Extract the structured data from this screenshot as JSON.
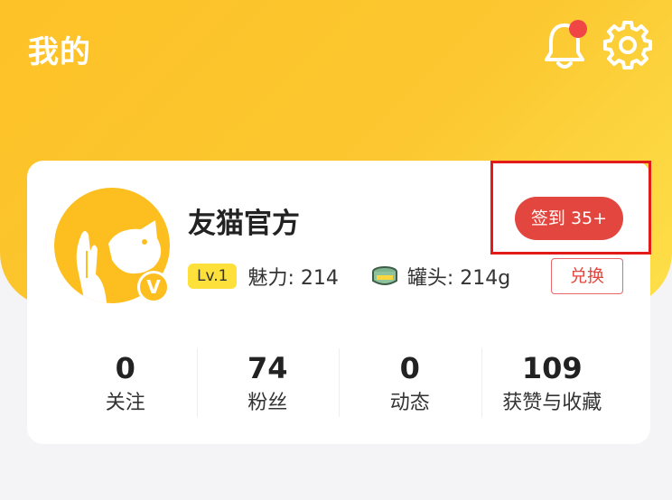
{
  "header": {
    "title": "我的"
  },
  "profile": {
    "name": "友猫官方",
    "level": "Lv.1",
    "charm": "魅力: 214",
    "cans": "罐头: 214g",
    "verified_mark": "V"
  },
  "actions": {
    "checkin_label": "签到 35+",
    "exchange_label": "兑换"
  },
  "counts": [
    {
      "value": "0",
      "label": "关注"
    },
    {
      "value": "74",
      "label": "粉丝"
    },
    {
      "value": "0",
      "label": "动态"
    },
    {
      "value": "109",
      "label": "获赞与收藏"
    }
  ],
  "colors": {
    "accent": "#fcc22a",
    "checkin": "#e2463e",
    "badge": "#fde13a",
    "notification_dot": "#f04646"
  },
  "icons": [
    "bell-icon",
    "gear-icon",
    "can-icon",
    "verified-icon"
  ]
}
